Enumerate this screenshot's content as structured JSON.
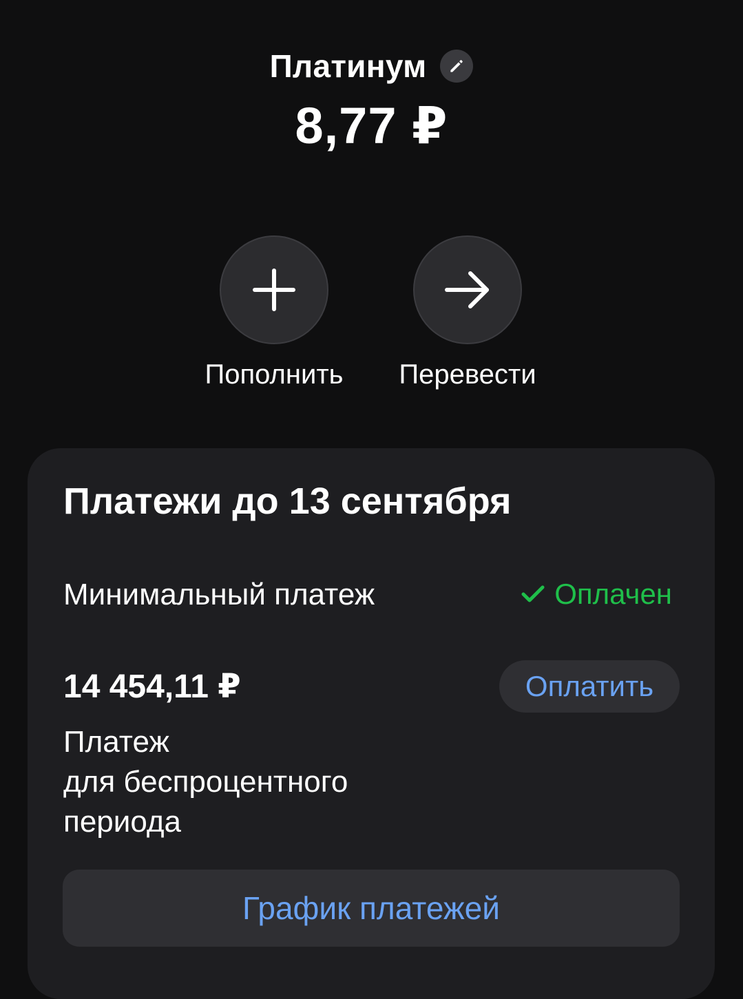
{
  "header": {
    "account_name": "Платинум",
    "balance": "8,77 ₽",
    "edit_icon": "pencil-icon"
  },
  "actions": [
    {
      "label": "Пополнить",
      "icon": "plus-icon"
    },
    {
      "label": "Перевести",
      "icon": "arrow-right-icon"
    }
  ],
  "payments_card": {
    "title": "Платежи до 13 сентября",
    "minimum_payment": {
      "label": "Минимальный платеж",
      "status": "Оплачен",
      "status_icon": "check-icon",
      "status_color": "#1fbf4a"
    },
    "grace_payment": {
      "amount": "14 454,11 ₽",
      "pay_label": "Оплатить",
      "description_lines": [
        "Платеж",
        "для беспроцентного",
        "периода"
      ]
    },
    "schedule_label": "График платежей"
  },
  "colors": {
    "background": "#0f0f10",
    "card": "#1e1e21",
    "accent_blue": "#6aa2f2",
    "success_green": "#1fbf4a"
  }
}
